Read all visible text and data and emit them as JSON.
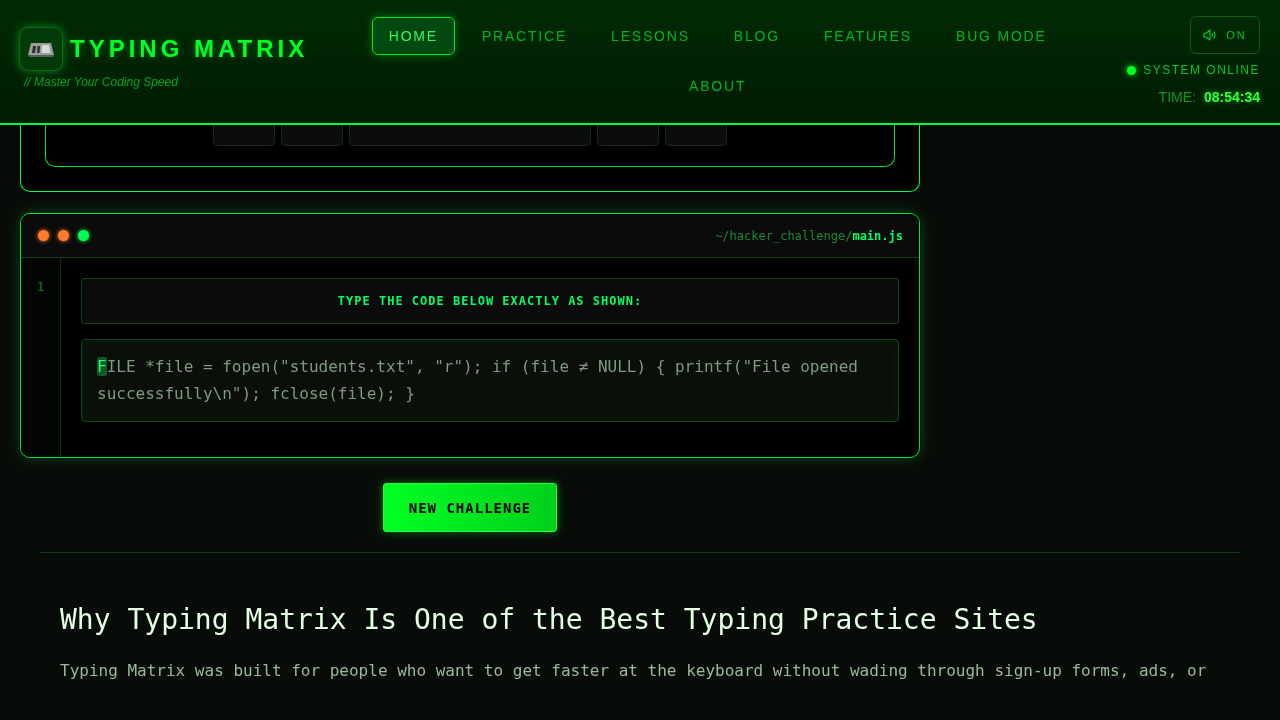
{
  "header": {
    "logo": {
      "title": "TYPING MATRIX",
      "tagline": "// Master Your Coding Speed"
    },
    "nav": [
      {
        "label": "HOME",
        "selected": true
      },
      {
        "label": "PRACTICE",
        "selected": false
      },
      {
        "label": "LESSONS",
        "selected": false
      },
      {
        "label": "BLOG",
        "selected": false
      },
      {
        "label": "FEATURES",
        "selected": false
      },
      {
        "label": "BUG MODE",
        "selected": false
      },
      {
        "label": "ABOUT",
        "selected": false
      }
    ],
    "sound_toggle": {
      "label": "ON"
    },
    "status": {
      "label": "SYSTEM ONLINE",
      "online": true
    },
    "clock": {
      "label": "TIME:",
      "value": "08:54:34"
    }
  },
  "keyboard": {
    "keys": [
      {
        "kind": "key"
      },
      {
        "kind": "key"
      },
      {
        "kind": "space"
      },
      {
        "kind": "key"
      },
      {
        "kind": "key"
      }
    ]
  },
  "editor": {
    "window_dots": [
      {
        "color": "#ff7a2a"
      },
      {
        "color": "#ff7a2a"
      },
      {
        "color": "#00ff55"
      }
    ],
    "path": "~/hacker_challenge/**main.js**",
    "line_numbers": [
      "1"
    ],
    "instruction": "TYPE THE CODE BELOW EXACTLY AS SHOWN:",
    "code": {
      "current": "F",
      "remaining": "ILE *file = fopen(\"students.txt\", \"r\"); if (file ≠ NULL) { printf(\"File opened successfully\\n\"); fclose(file); }"
    }
  },
  "new_challenge_button": "NEW CHALLENGE",
  "article": {
    "heading": "Why Typing Matrix Is One of the Best Typing Practice Sites",
    "paragraph": "Typing Matrix was built for people who want to get faster at the keyboard without wading through sign-up forms, ads, or"
  }
}
